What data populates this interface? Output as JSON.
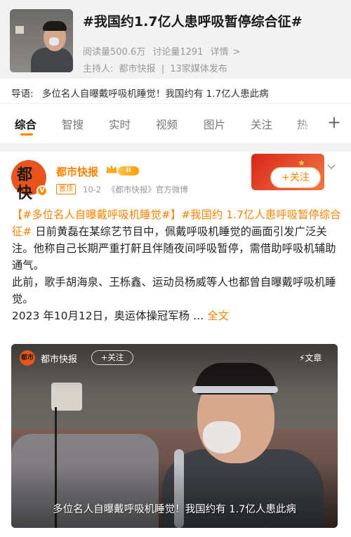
{
  "topic": {
    "title": "#我国约1.7亿人患呼吸暂停综合征#",
    "views": "阅读量500.6万",
    "discussions": "讨论量1291",
    "details": "详情",
    "details_arrow": ">",
    "host_label": "主持人:",
    "host_name": "都市快报",
    "host_divider": "|",
    "media_count": "13家媒体发布"
  },
  "intro": {
    "label": "导语:",
    "text": "多位名人自曝戴呼吸机睡觉！我国约有 1.7亿人患此病"
  },
  "tabs": [
    {
      "label": "综合",
      "active": true
    },
    {
      "label": "智搜",
      "active": false
    },
    {
      "label": "实时",
      "active": false
    },
    {
      "label": "视频",
      "active": false
    },
    {
      "label": "图片",
      "active": false
    },
    {
      "label": "关注",
      "active": false
    },
    {
      "label": "热",
      "active": false
    }
  ],
  "tabs_more": "+",
  "post": {
    "author": "都市快报",
    "avatar_text": "都市\n快报",
    "avatar_verified": "V",
    "level": "II",
    "pin_badge": "置顶",
    "date": "10-2",
    "source": "《都市快报》官方微博",
    "follow_button": "+关注",
    "hashtag_1": "【#多位名人自曝戴呼吸机睡觉#】",
    "hashtag_2": "#我国约 1.7亿人患呼吸暂停综合征#",
    "body_1": " 日前黄磊在某综艺节目中，佩戴呼吸机睡觉的画面引发广泛关注。他称自己长期严重打鼾且伴随夜间呼吸暂停，需借助呼吸机辅助通气。",
    "body_2": "此前，歌手胡海泉、王栎鑫、运动员杨威等人也都曾自曝戴呼吸机睡觉。",
    "body_3": "2023 年10月12日，奥运体操冠军杨 ... ",
    "read_more": "全文"
  },
  "video": {
    "author": "都市快报",
    "avatar_text": "都市",
    "follow_button": "+关注",
    "article_tag": "⚡文章",
    "caption": "多位名人自曝戴呼吸机睡觉！我国约有 1.7亿人患此病"
  },
  "colors": {
    "accent": "#ff8200",
    "header_bg": "#f2f2f2"
  }
}
